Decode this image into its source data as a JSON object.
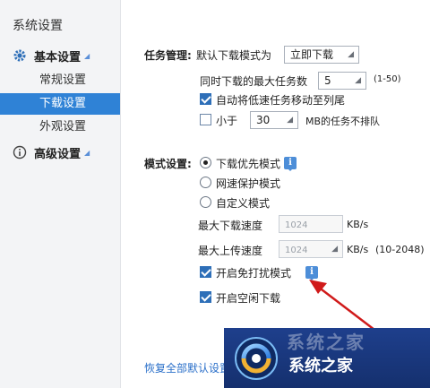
{
  "sidebar": {
    "title": "系统设置",
    "groups": [
      {
        "label": "基本设置",
        "icon": "gear-icon"
      },
      {
        "label": "高级设置",
        "icon": "info-circle-icon"
      }
    ],
    "items": [
      {
        "label": "常规设置",
        "active": false
      },
      {
        "label": "下载设置",
        "active": true
      },
      {
        "label": "外观设置",
        "active": false
      }
    ]
  },
  "task": {
    "section_label": "任务管理:",
    "default_mode_label": "默认下载模式为",
    "default_mode_value": "立即下载",
    "max_tasks_label": "同时下载的最大任务数",
    "max_tasks_value": "5",
    "max_tasks_range": "(1-50)",
    "auto_move_label": "自动将低速任务移动至列尾",
    "auto_move_checked": true,
    "less_than_label": "小于",
    "less_than_checked": false,
    "less_than_value": "30",
    "less_than_suffix": "MB的任务不排队"
  },
  "mode": {
    "section_label": "模式设置:",
    "options": [
      {
        "label": "下载优先模式",
        "selected": true
      },
      {
        "label": "网速保护模式",
        "selected": false
      },
      {
        "label": "自定义模式",
        "selected": false
      }
    ],
    "max_download_label": "最大下载速度",
    "max_download_value": "1024",
    "max_download_unit": "KB/s",
    "max_upload_label": "最大上传速度",
    "max_upload_value": "1024",
    "max_upload_unit": "KB/s",
    "max_upload_range": "(10-2048)",
    "no_disturb_label": "开启免打扰模式",
    "no_disturb_checked": true,
    "idle_download_label": "开启空闲下载",
    "idle_download_checked": true
  },
  "footer": {
    "restore_link": "恢复全部默认设置"
  },
  "watermark": {
    "text": "系统之家",
    "faint_text": "系统之家"
  }
}
